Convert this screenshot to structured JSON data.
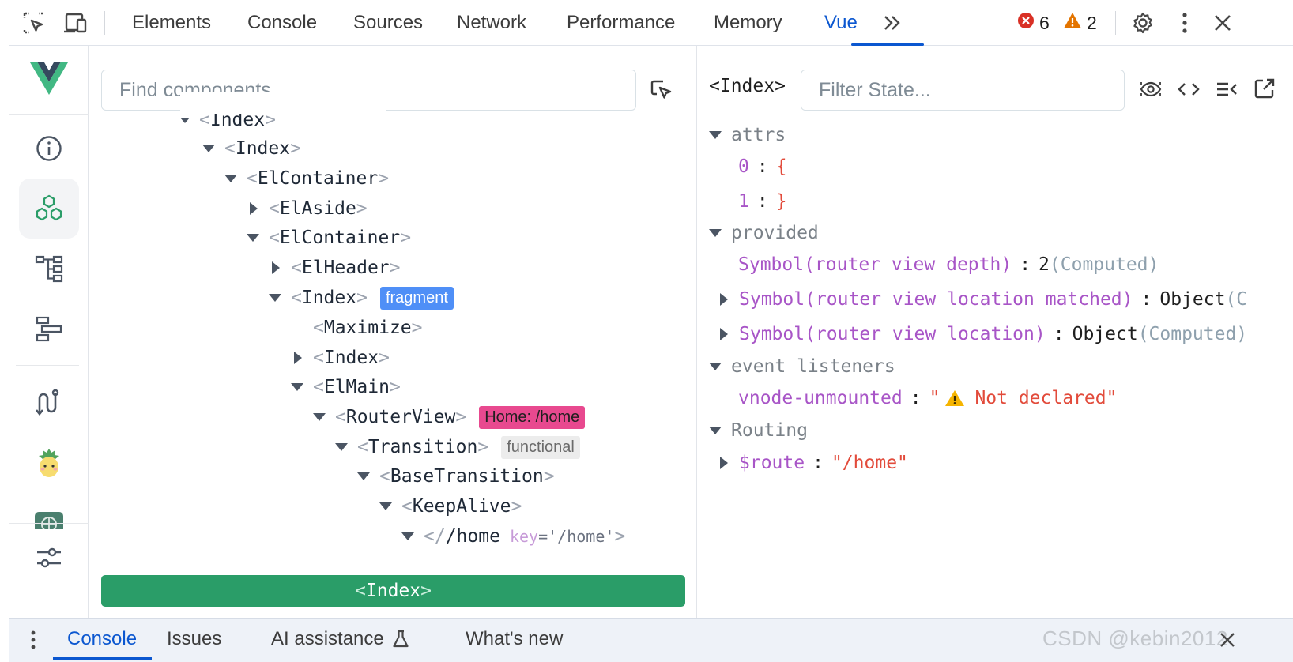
{
  "toolbar": {
    "tabs": [
      {
        "label": "Elements"
      },
      {
        "label": "Console"
      },
      {
        "label": "Sources"
      },
      {
        "label": "Network"
      },
      {
        "label": "Performance"
      },
      {
        "label": "Memory"
      },
      {
        "label": "Vue"
      }
    ],
    "active_tab": "Vue",
    "more_tabs_icon": "chevrons-right-icon",
    "error_count": "6",
    "warning_count": "2",
    "icons": [
      "inspect-element-icon",
      "device-toggle-icon",
      "error-icon",
      "warning-icon",
      "gear-icon",
      "kebab-menu-icon",
      "close-icon"
    ],
    "colors": {
      "accent": "#0b57d0",
      "error": "#d93025",
      "warning": "#e37400"
    }
  },
  "sidebar": {
    "items": [
      {
        "name": "vue-logo",
        "active": false
      },
      {
        "name": "info-icon",
        "active": false
      },
      {
        "name": "components-icon",
        "active": true
      },
      {
        "name": "tree-icon",
        "active": false
      },
      {
        "name": "timeline-icon",
        "active": false
      },
      {
        "name": "router-icon",
        "active": false
      },
      {
        "name": "pinia-icon",
        "active": false
      },
      {
        "name": "globe-icon",
        "active": false
      },
      {
        "name": "settings-sliders-icon",
        "active": false
      }
    ]
  },
  "tree": {
    "search_placeholder": "Find components...",
    "rows": [
      {
        "name": "Index",
        "expanded": true,
        "clipped": true
      },
      {
        "name": "Index",
        "expanded": true
      },
      {
        "name": "ElContainer",
        "expanded": true
      },
      {
        "name": "ElAside",
        "expanded": false
      },
      {
        "name": "ElContainer",
        "expanded": true
      },
      {
        "name": "ElHeader",
        "expanded": false
      },
      {
        "name": "Index",
        "expanded": true,
        "badge": "fragment"
      },
      {
        "name": "Maximize",
        "leaf": true
      },
      {
        "name": "Index",
        "expanded": false
      },
      {
        "name": "ElMain",
        "expanded": true
      },
      {
        "name": "RouterView",
        "expanded": true,
        "badge": "Home: /home"
      },
      {
        "name": "Transition",
        "expanded": true,
        "badge": "functional"
      },
      {
        "name": "BaseTransition",
        "expanded": true
      },
      {
        "name": "KeepAlive",
        "expanded": true
      },
      {
        "name": "/home",
        "expanded": true,
        "attr_key": "key",
        "attr_value": "'/home'"
      }
    ],
    "selected": "Index",
    "open_bracket": "<",
    "close_bracket": ">",
    "slash_open": "</",
    "equals": "=",
    "colors": {
      "selected_bg": "#2a9d68",
      "fragment_badge": "#4f8ff7",
      "route_badge": "#e8498f",
      "functional_badge": "#ececec"
    }
  },
  "state": {
    "component_name": "<Index>",
    "filter_placeholder": "Filter State...",
    "header_icons": [
      "eye-icon",
      "code-icon",
      "collapse-icon",
      "open-external-icon"
    ],
    "sections": [
      {
        "title": "attrs",
        "entries": [
          {
            "key": "0",
            "value": "{"
          },
          {
            "key": "1",
            "value": "}"
          }
        ]
      },
      {
        "title": "provided",
        "entries": [
          {
            "key": "Symbol(router view depth)",
            "value": "2",
            "suffix": "(Computed)",
            "expandable": false
          },
          {
            "key": "Symbol(router view location matched)",
            "value": "Object",
            "suffix": "(C",
            "expandable": true
          },
          {
            "key": "Symbol(router view location)",
            "value": "Object",
            "suffix": "(Computed)",
            "expandable": true
          }
        ]
      },
      {
        "title": "event listeners",
        "entries": [
          {
            "key": "vnode-unmounted",
            "value_open": "\"",
            "value_text": "Not declared\"",
            "icon": "warning-icon"
          }
        ]
      },
      {
        "title": "Routing",
        "entries": [
          {
            "key": "$route",
            "value": "\"/home\"",
            "expandable": true
          }
        ]
      }
    ],
    "colon": ":"
  },
  "drawer": {
    "tabs": [
      {
        "label": "Console"
      },
      {
        "label": "Issues"
      },
      {
        "label": "AI assistance"
      },
      {
        "label": "What's new"
      }
    ],
    "active_tab": "Console",
    "watermark": "CSDN @kebin2012",
    "icons": [
      "kebab-menu-icon",
      "flask-icon",
      "close-icon"
    ]
  }
}
